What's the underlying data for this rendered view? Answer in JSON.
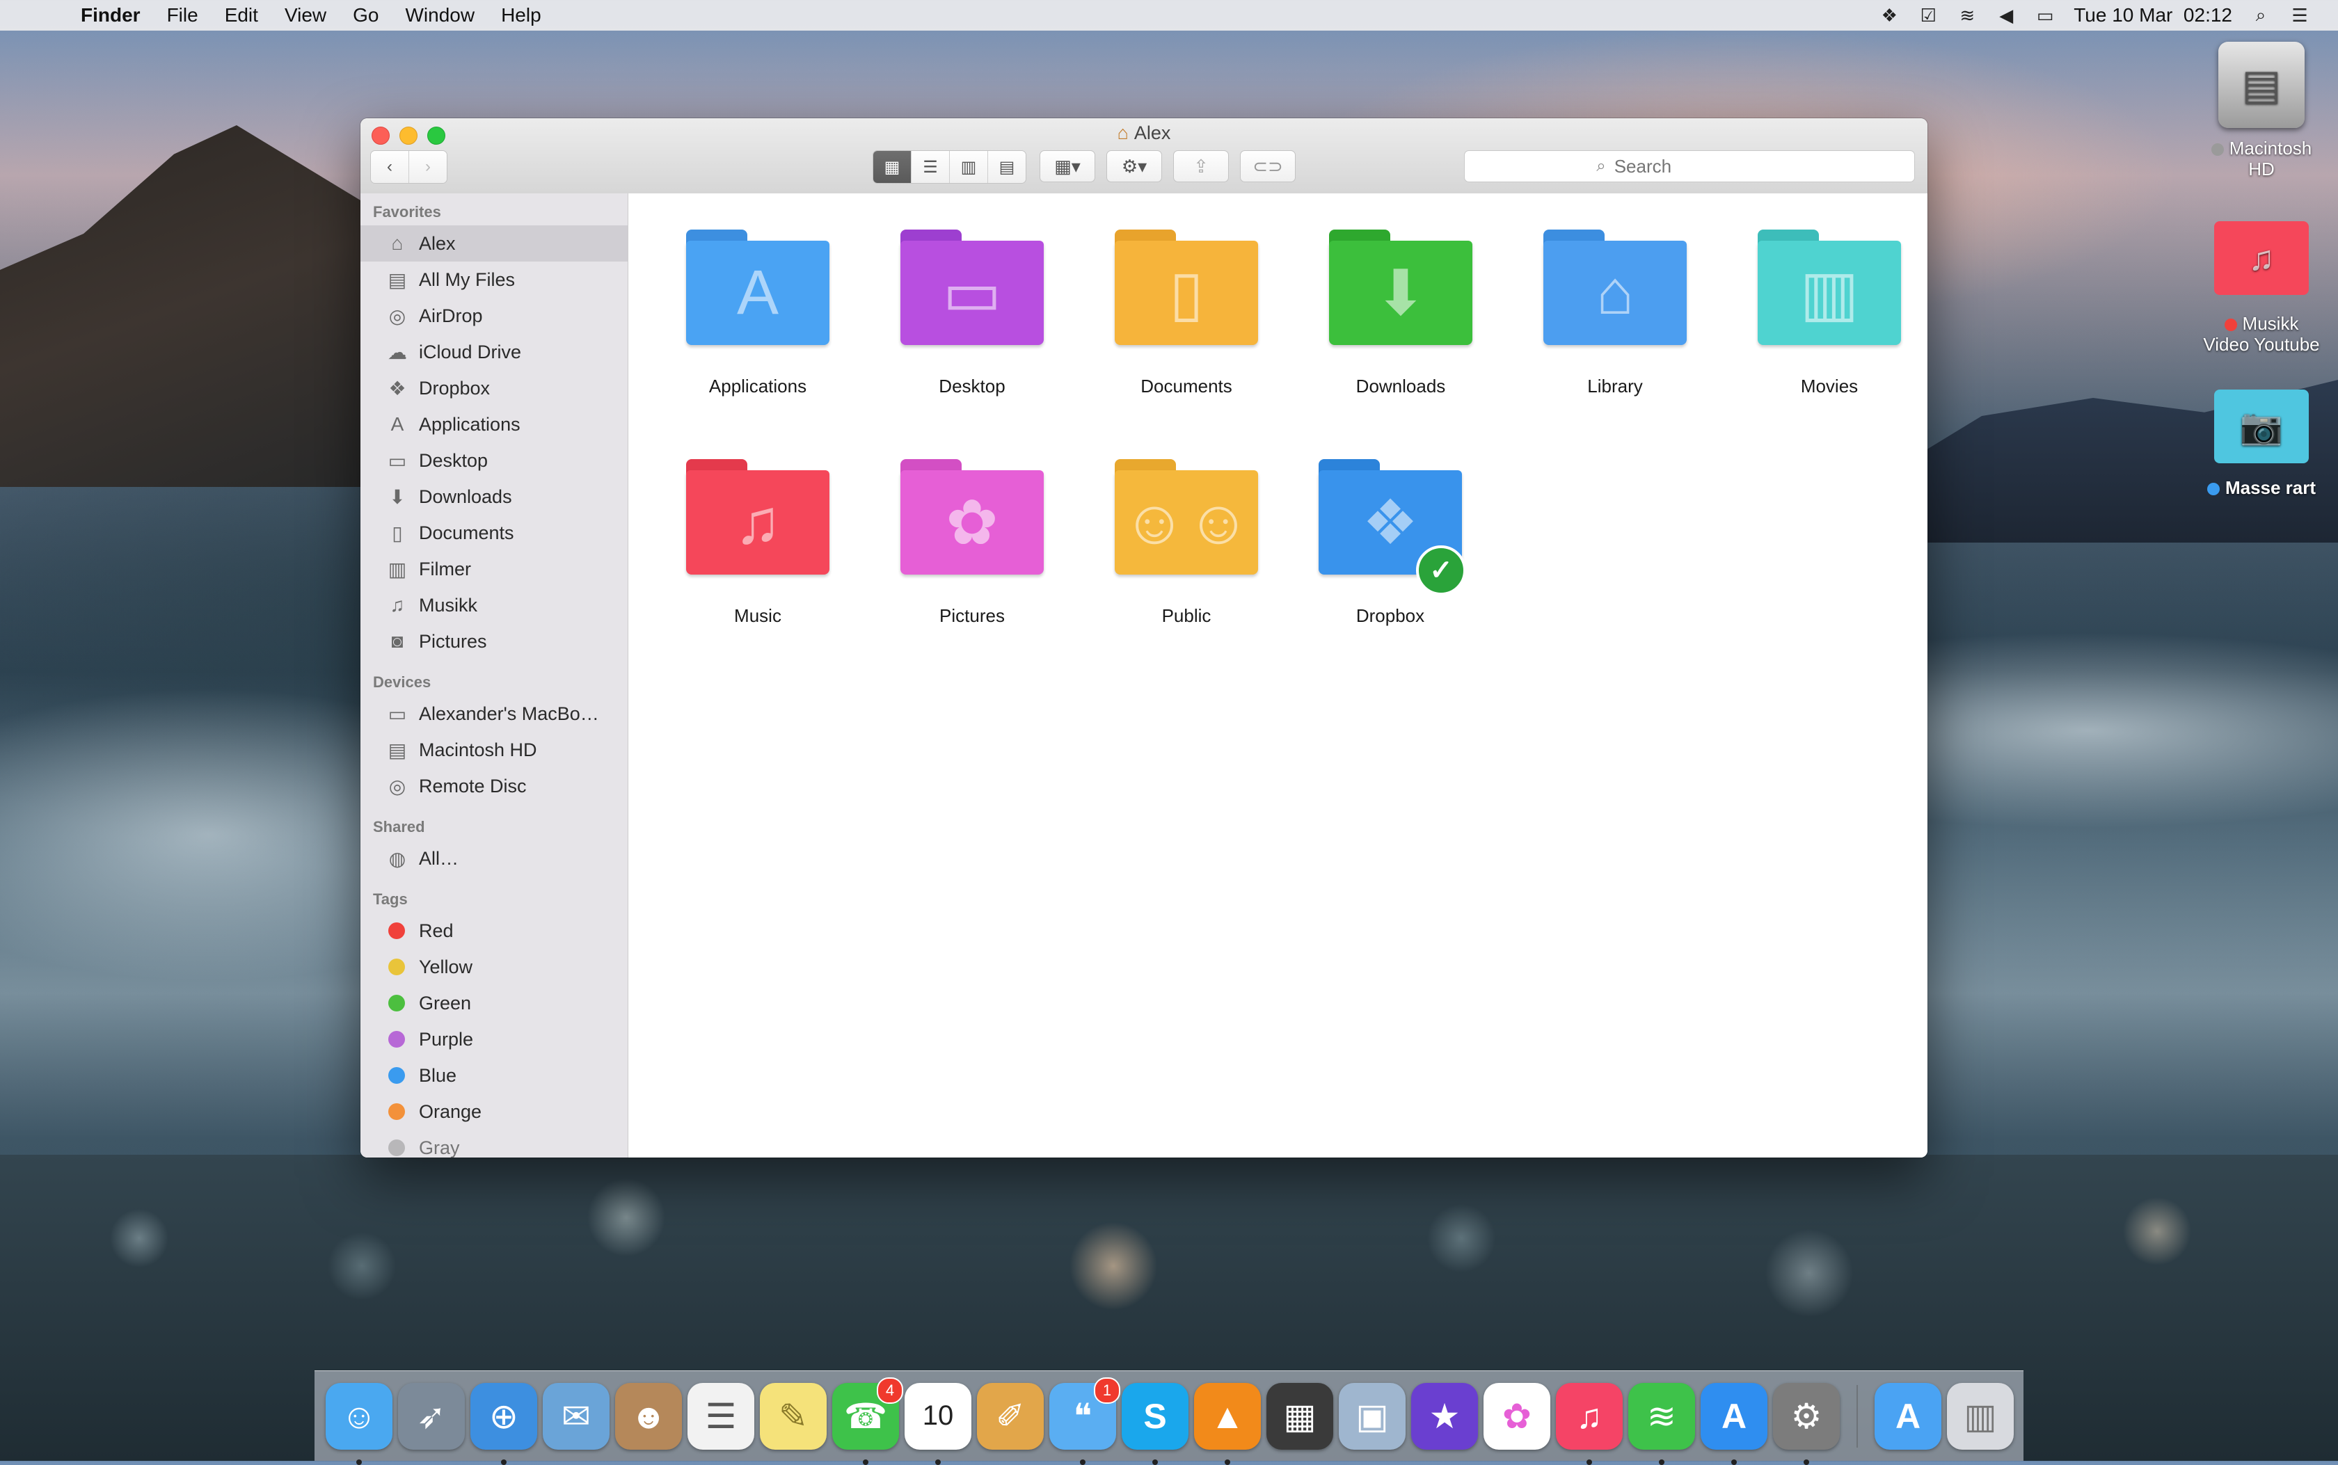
{
  "menubar": {
    "app": "Finder",
    "items": [
      "File",
      "Edit",
      "View",
      "Go",
      "Window",
      "Help"
    ],
    "datetime": "Tue 10 Mar  02:12"
  },
  "window": {
    "title": "Alex",
    "search_placeholder": "Search"
  },
  "sidebar": {
    "favorites_header": "Favorites",
    "favorites": [
      {
        "label": "Alex",
        "icon": "home-icon"
      },
      {
        "label": "All My Files",
        "icon": "all-files-icon"
      },
      {
        "label": "AirDrop",
        "icon": "airdrop-icon"
      },
      {
        "label": "iCloud Drive",
        "icon": "cloud-icon"
      },
      {
        "label": "Dropbox",
        "icon": "dropbox-icon"
      },
      {
        "label": "Applications",
        "icon": "applications-icon"
      },
      {
        "label": "Desktop",
        "icon": "desktop-icon"
      },
      {
        "label": "Downloads",
        "icon": "downloads-icon"
      },
      {
        "label": "Documents",
        "icon": "documents-icon"
      },
      {
        "label": "Filmer",
        "icon": "film-icon"
      },
      {
        "label": "Musikk",
        "icon": "music-note-icon"
      },
      {
        "label": "Pictures",
        "icon": "camera-icon"
      }
    ],
    "devices_header": "Devices",
    "devices": [
      {
        "label": "Alexander's MacBo…",
        "icon": "laptop-icon"
      },
      {
        "label": "Macintosh HD",
        "icon": "hard-drive-icon"
      },
      {
        "label": "Remote Disc",
        "icon": "disc-icon"
      }
    ],
    "shared_header": "Shared",
    "shared": [
      {
        "label": "All…",
        "icon": "network-icon"
      }
    ],
    "tags_header": "Tags",
    "tags": [
      {
        "label": "Red",
        "color": "#f0413b"
      },
      {
        "label": "Yellow",
        "color": "#e9c43a"
      },
      {
        "label": "Green",
        "color": "#4cbf3f"
      },
      {
        "label": "Purple",
        "color": "#b768d6"
      },
      {
        "label": "Blue",
        "color": "#3a9bef"
      },
      {
        "label": "Orange",
        "color": "#f3913a"
      },
      {
        "label": "Gray",
        "color": "#9a9a9a"
      }
    ]
  },
  "content": {
    "items": [
      {
        "label": "Applications",
        "color": "#4aa3f3",
        "icon": "applications-icon"
      },
      {
        "label": "Desktop",
        "color": "#b84fe0",
        "icon": "desktop-icon"
      },
      {
        "label": "Documents",
        "color": "#f6b43b",
        "icon": "document-icon"
      },
      {
        "label": "Downloads",
        "color": "#3cbf3c",
        "icon": "download-arrow-icon"
      },
      {
        "label": "Library",
        "color": "#4c9ef0",
        "icon": "library-icon"
      },
      {
        "label": "Movies",
        "color": "#4fd3d0",
        "icon": "film-icon"
      },
      {
        "label": "Music",
        "color": "#f5475a",
        "icon": "music-note-icon"
      },
      {
        "label": "Pictures",
        "color": "#e65fd6",
        "icon": "flower-icon"
      },
      {
        "label": "Public",
        "color": "#f5b83c",
        "icon": "people-icon"
      },
      {
        "label": "Dropbox",
        "color": "#3993ec",
        "icon": "dropbox-icon"
      }
    ]
  },
  "desktop": {
    "items": [
      {
        "label": "Macintosh HD",
        "dot_color": "#9a9a9a"
      },
      {
        "label": "Musikk Video Youtube",
        "dot_color": "#f0413b"
      },
      {
        "label": "Masse rart",
        "dot_color": "#3a9bef"
      }
    ]
  },
  "dock": {
    "apps": [
      {
        "name": "finder-icon",
        "bg": "#4aa8f0",
        "glyph": "☺",
        "running": true
      },
      {
        "name": "launchpad-icon",
        "bg": "#7c8a99",
        "glyph": "🚀",
        "running": false
      },
      {
        "name": "safari-icon",
        "bg": "#3d8fe0",
        "glyph": "⊕",
        "running": true
      },
      {
        "name": "mail-icon",
        "bg": "#6aa4d8",
        "glyph": "✉",
        "running": false
      },
      {
        "name": "contacts-icon",
        "bg": "#b5885a",
        "glyph": "☻",
        "running": false
      },
      {
        "name": "reminders-icon",
        "bg": "#f2f2f2",
        "glyph": "☰",
        "running": false
      },
      {
        "name": "notes-icon",
        "bg": "#f5e27a",
        "glyph": "✎",
        "running": false
      },
      {
        "name": "facetime-icon",
        "bg": "#3ec24a",
        "glyph": "☎",
        "badge": "4",
        "running": true
      },
      {
        "name": "calendar-icon",
        "bg": "#ffffff",
        "glyph": "10",
        "running": true
      },
      {
        "name": "logic-icon",
        "bg": "#e2a64a",
        "glyph": "✐",
        "running": false
      },
      {
        "name": "messages-icon",
        "bg": "#5aaef2",
        "glyph": "💬",
        "badge": "1",
        "running": true
      },
      {
        "name": "skype-icon",
        "bg": "#1aa7ec",
        "glyph": "S",
        "running": true
      },
      {
        "name": "vlc-icon",
        "bg": "#f28a1a",
        "glyph": "▲",
        "running": true
      },
      {
        "name": "final-cut-icon",
        "bg": "#3a3a3a",
        "glyph": "🎬",
        "running": false
      },
      {
        "name": "preview-icon",
        "bg": "#9fb6cf",
        "glyph": "🖼",
        "running": false
      },
      {
        "name": "imovie-icon",
        "bg": "#6a3fd0",
        "glyph": "★",
        "running": false
      },
      {
        "name": "photos-icon",
        "bg": "#ffffff",
        "glyph": "✿",
        "running": false
      },
      {
        "name": "itunes-icon",
        "bg": "#f54466",
        "glyph": "♫",
        "running": true
      },
      {
        "name": "spotify-icon",
        "bg": "#3ec24a",
        "glyph": "≋",
        "running": true
      },
      {
        "name": "app-store-icon",
        "bg": "#2f8ef0",
        "glyph": "A",
        "running": true
      },
      {
        "name": "system-preferences-icon",
        "bg": "#7c7c7c",
        "glyph": "⚙",
        "running": true
      }
    ],
    "right": [
      {
        "name": "applications-folder-icon",
        "bg": "#4aa3f3",
        "glyph": "A"
      },
      {
        "name": "trash-icon",
        "bg": "#d8dadf",
        "glyph": "🗑"
      }
    ]
  }
}
